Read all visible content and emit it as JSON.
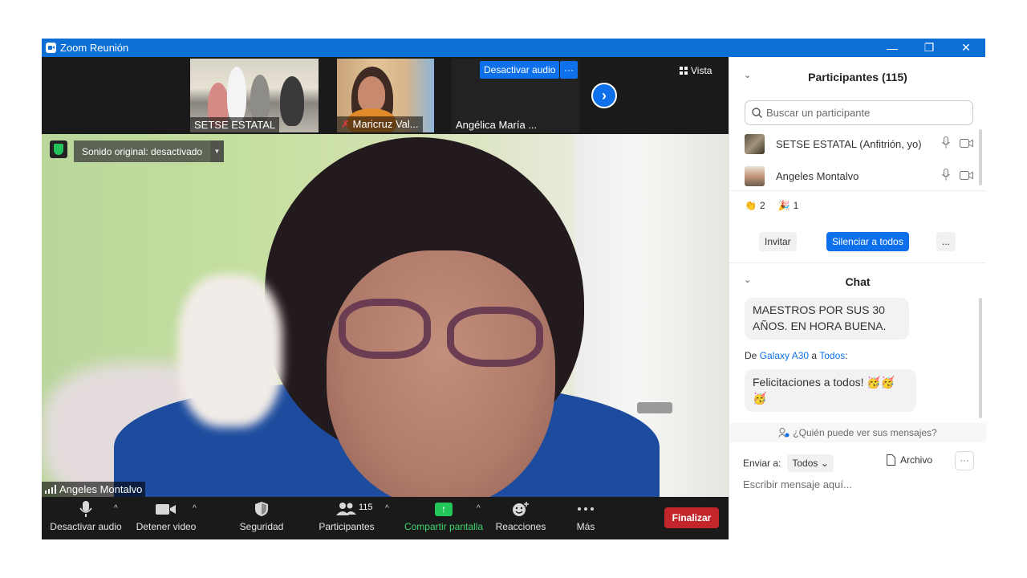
{
  "window": {
    "title": "Zoom Reunión",
    "minimize_icon": "—",
    "restore_icon": "❐",
    "close_icon": "✕"
  },
  "thumbnails": [
    {
      "name": "SETSE ESTATAL"
    },
    {
      "name": "Maricruz Val..."
    },
    {
      "name": "Angélica María ..."
    }
  ],
  "top_controls": {
    "unmute_label": "Desactivar audio",
    "more_label": "···",
    "next_arrow": "›",
    "view_label": "Vista"
  },
  "speaker": {
    "original_sound": "Sonido original: desactivado",
    "dropdown": "▼",
    "name": "Angeles Montalvo"
  },
  "toolbar": {
    "audio": "Desactivar audio",
    "video": "Detener video",
    "security": "Seguridad",
    "participants": "Participantes",
    "participants_count": "115",
    "share": "Compartir pantalla",
    "reactions": "Reacciones",
    "more": "Más",
    "end": "Finalizar",
    "caret": "^"
  },
  "participants_panel": {
    "title": "Participantes (115)",
    "chevron": "⌄",
    "search_placeholder": "Buscar un participante",
    "rows": [
      {
        "name": "SETSE ESTATAL (Anfitrión, yo)"
      },
      {
        "name": "Angeles Montalvo"
      }
    ],
    "reactions": [
      {
        "emoji": "👏",
        "count": "2"
      },
      {
        "emoji": "🎉",
        "count": "1"
      }
    ],
    "invite": "Invitar",
    "mute_all": "Silenciar a todos",
    "more": "..."
  },
  "chat_panel": {
    "title": "Chat",
    "chevron": "⌄",
    "message1": "MAESTROS POR SUS 30 AÑOS. EN HORA BUENA.",
    "from_prefix": "De",
    "from_sender": "Galaxy A30",
    "from_mid": "a",
    "from_target": "Todos",
    "from_suffix": ":",
    "message2": "Felicitaciones a todos! 🥳🥳🥳",
    "who_sees": "¿Quién puede ver sus mensajes?",
    "send_to_label": "Enviar a:",
    "send_to_value": "Todos ⌄",
    "file_label": "Archivo",
    "more": "···",
    "input_placeholder": "Escribir mensaje aquí..."
  },
  "colors": {
    "accent": "#0e71eb",
    "title_bar": "#0b6fd6",
    "end_button": "#c2262b",
    "share_green": "#23c65a"
  },
  "icons": {
    "mic": "mic-icon",
    "camera": "camera-icon",
    "shield": "shield-icon",
    "people": "people-icon",
    "share": "share-screen-icon",
    "reaction": "emoji-icon",
    "more": "more-icon",
    "search": "search-icon",
    "file": "file-icon"
  }
}
